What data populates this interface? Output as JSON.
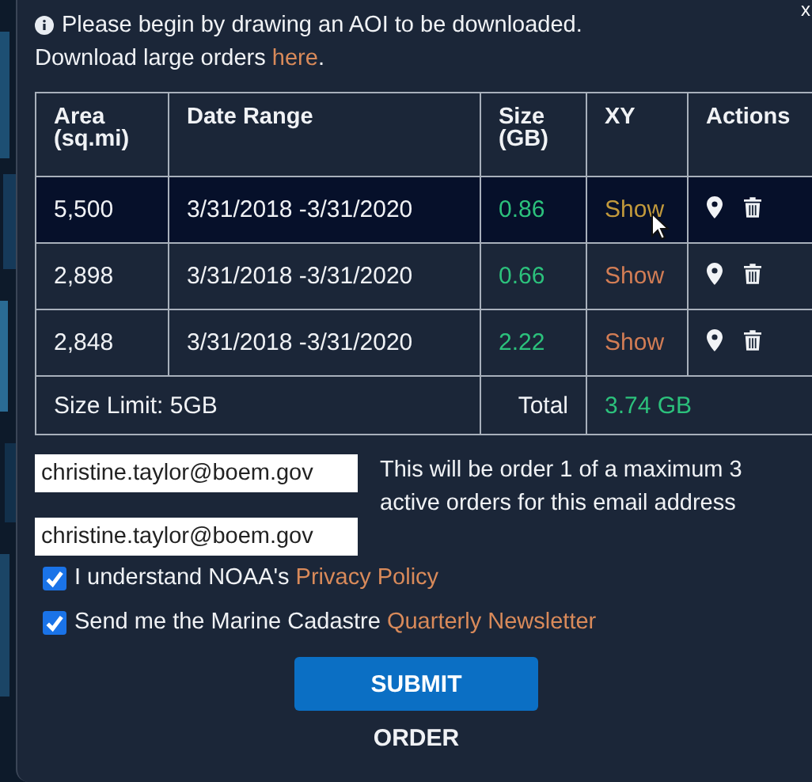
{
  "info": {
    "text": "Please begin by drawing an AOI to be downloaded.",
    "line2": "Download large orders ",
    "link": "here",
    "after": "."
  },
  "close": "x",
  "table": {
    "columns": [
      "Area (sq.mi)",
      "Date Range",
      "Size (GB)",
      "XY",
      "Actions"
    ],
    "rows": [
      {
        "area": "5,500",
        "date_range": "3/31/2018 -3/31/2020",
        "size": "0.86",
        "xy": "Show",
        "selected": true
      },
      {
        "area": "2,898",
        "date_range": "3/31/2018 -3/31/2020",
        "size": "0.66",
        "xy": "Show",
        "selected": false
      },
      {
        "area": "2,848",
        "date_range": "3/31/2018 -3/31/2020",
        "size": "2.22",
        "xy": "Show",
        "selected": false
      }
    ],
    "footer": {
      "limit": "Size Limit: 5GB",
      "total_label": "Total",
      "total": "3.74 GB"
    }
  },
  "emails": [
    {
      "value": "christine.taylor@boem.gov"
    },
    {
      "value": "christine.taylor@boem.gov"
    }
  ],
  "note": "This will be order 1 of a maximum 3 active orders for this email address",
  "checks": [
    {
      "text": "I understand NOAA's ",
      "link": "Privacy Policy",
      "checked": true
    },
    {
      "text": "Send me the Marine Cadastre ",
      "link": "Quarterly Newsletter",
      "checked": true
    }
  ],
  "submit": "SUBMIT",
  "order": "ORDER"
}
